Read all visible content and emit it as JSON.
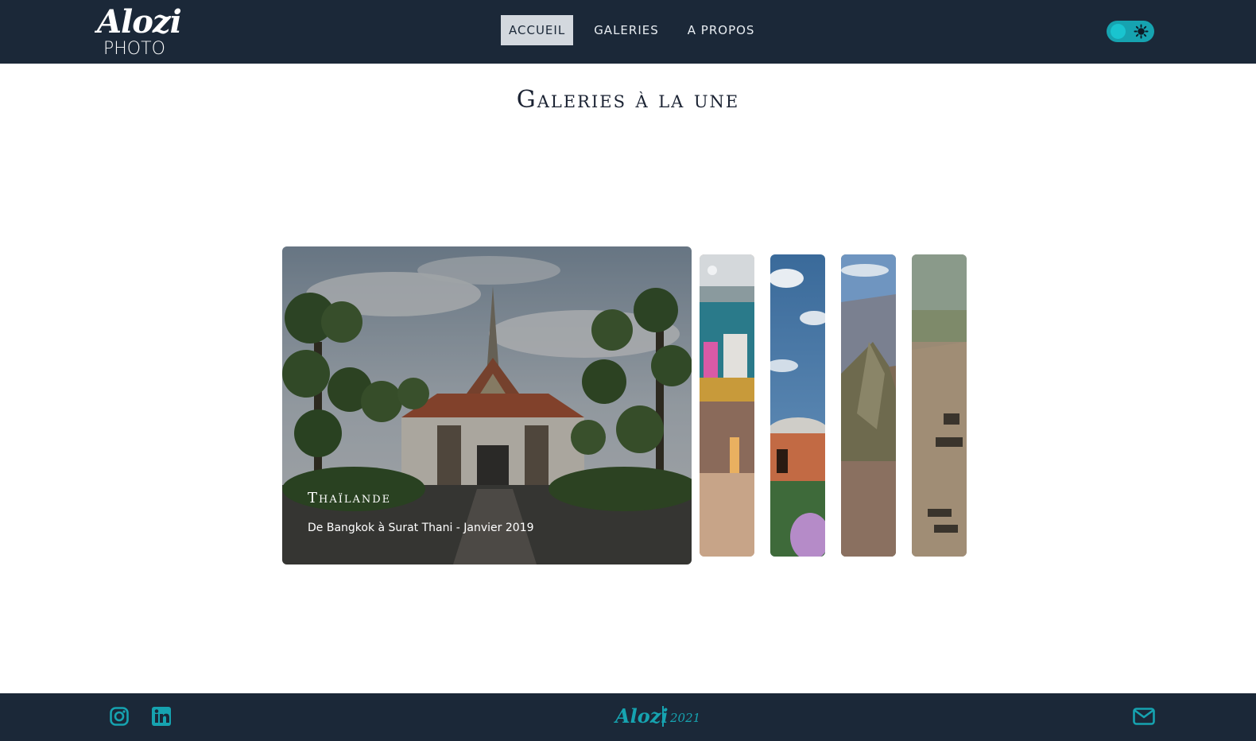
{
  "header": {
    "logo_script": "Alozi",
    "logo_sub": "PHOTO",
    "nav": [
      {
        "label": "Accueil",
        "active": true
      },
      {
        "label": "Galeries",
        "active": false
      },
      {
        "label": "A propos",
        "active": false
      }
    ],
    "theme_toggle_icon": "sun-icon"
  },
  "main": {
    "title": "Galeries à la une",
    "featured": {
      "title": "Thaïlande",
      "subtitle": "De Bangkok à Surat Thani - Janvier 2019"
    },
    "strips": [
      {
        "icon": "gallery-thumbnail"
      },
      {
        "icon": "gallery-thumbnail"
      },
      {
        "icon": "gallery-thumbnail"
      },
      {
        "icon": "gallery-thumbnail"
      }
    ]
  },
  "footer": {
    "brand": "Alozi",
    "year": "2021",
    "social": [
      "instagram-icon",
      "linkedin-icon"
    ],
    "contact_icon": "mail-icon"
  },
  "colors": {
    "header_bg": "#1b2838",
    "accent": "#16a3b0",
    "active_nav_bg": "#d3d8de"
  }
}
